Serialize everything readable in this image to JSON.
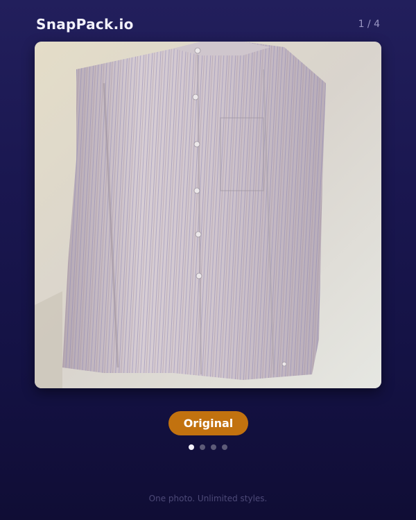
{
  "header": {
    "brand": "SnapPack.io",
    "counter": "1 / 4"
  },
  "photo": {
    "subject": "striped-shirt-photo"
  },
  "style_selector": {
    "label": "Original"
  },
  "carousel": {
    "total": 4,
    "active_index": 0
  },
  "footer": {
    "tagline": "One photo. Unlimited styles."
  },
  "colors": {
    "background_top": "#221f5c",
    "background_bottom": "#100d35",
    "accent": "#c2720f",
    "dot_active": "#f2f1fb",
    "dot_inactive": "#5d5b78"
  }
}
